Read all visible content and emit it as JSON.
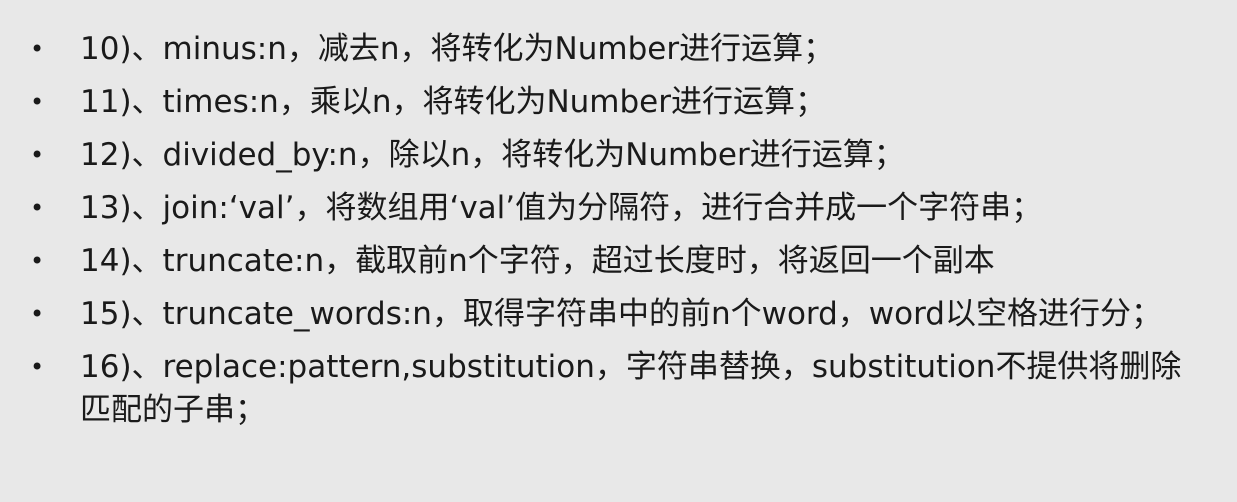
{
  "items": [
    "10)、minus:n，减去n，将转化为Number进行运算；",
    "11)、times:n，乘以n，将转化为Number进行运算；",
    "12)、divided_by:n，除以n，将转化为Number进行运算；",
    "13)、join:‘val’，将数组用‘val’值为分隔符，进行合并成一个字符串；",
    "14)、truncate:n，截取前n个字符，超过长度时，将返回一个副本",
    "15)、truncate_words:n，取得字符串中的前n个word，word以空格进行分；",
    "16)、replace:pattern,substitution，字符串替换，substitution不提供将删除匹配的子串；"
  ],
  "bullet_glyph": "•"
}
